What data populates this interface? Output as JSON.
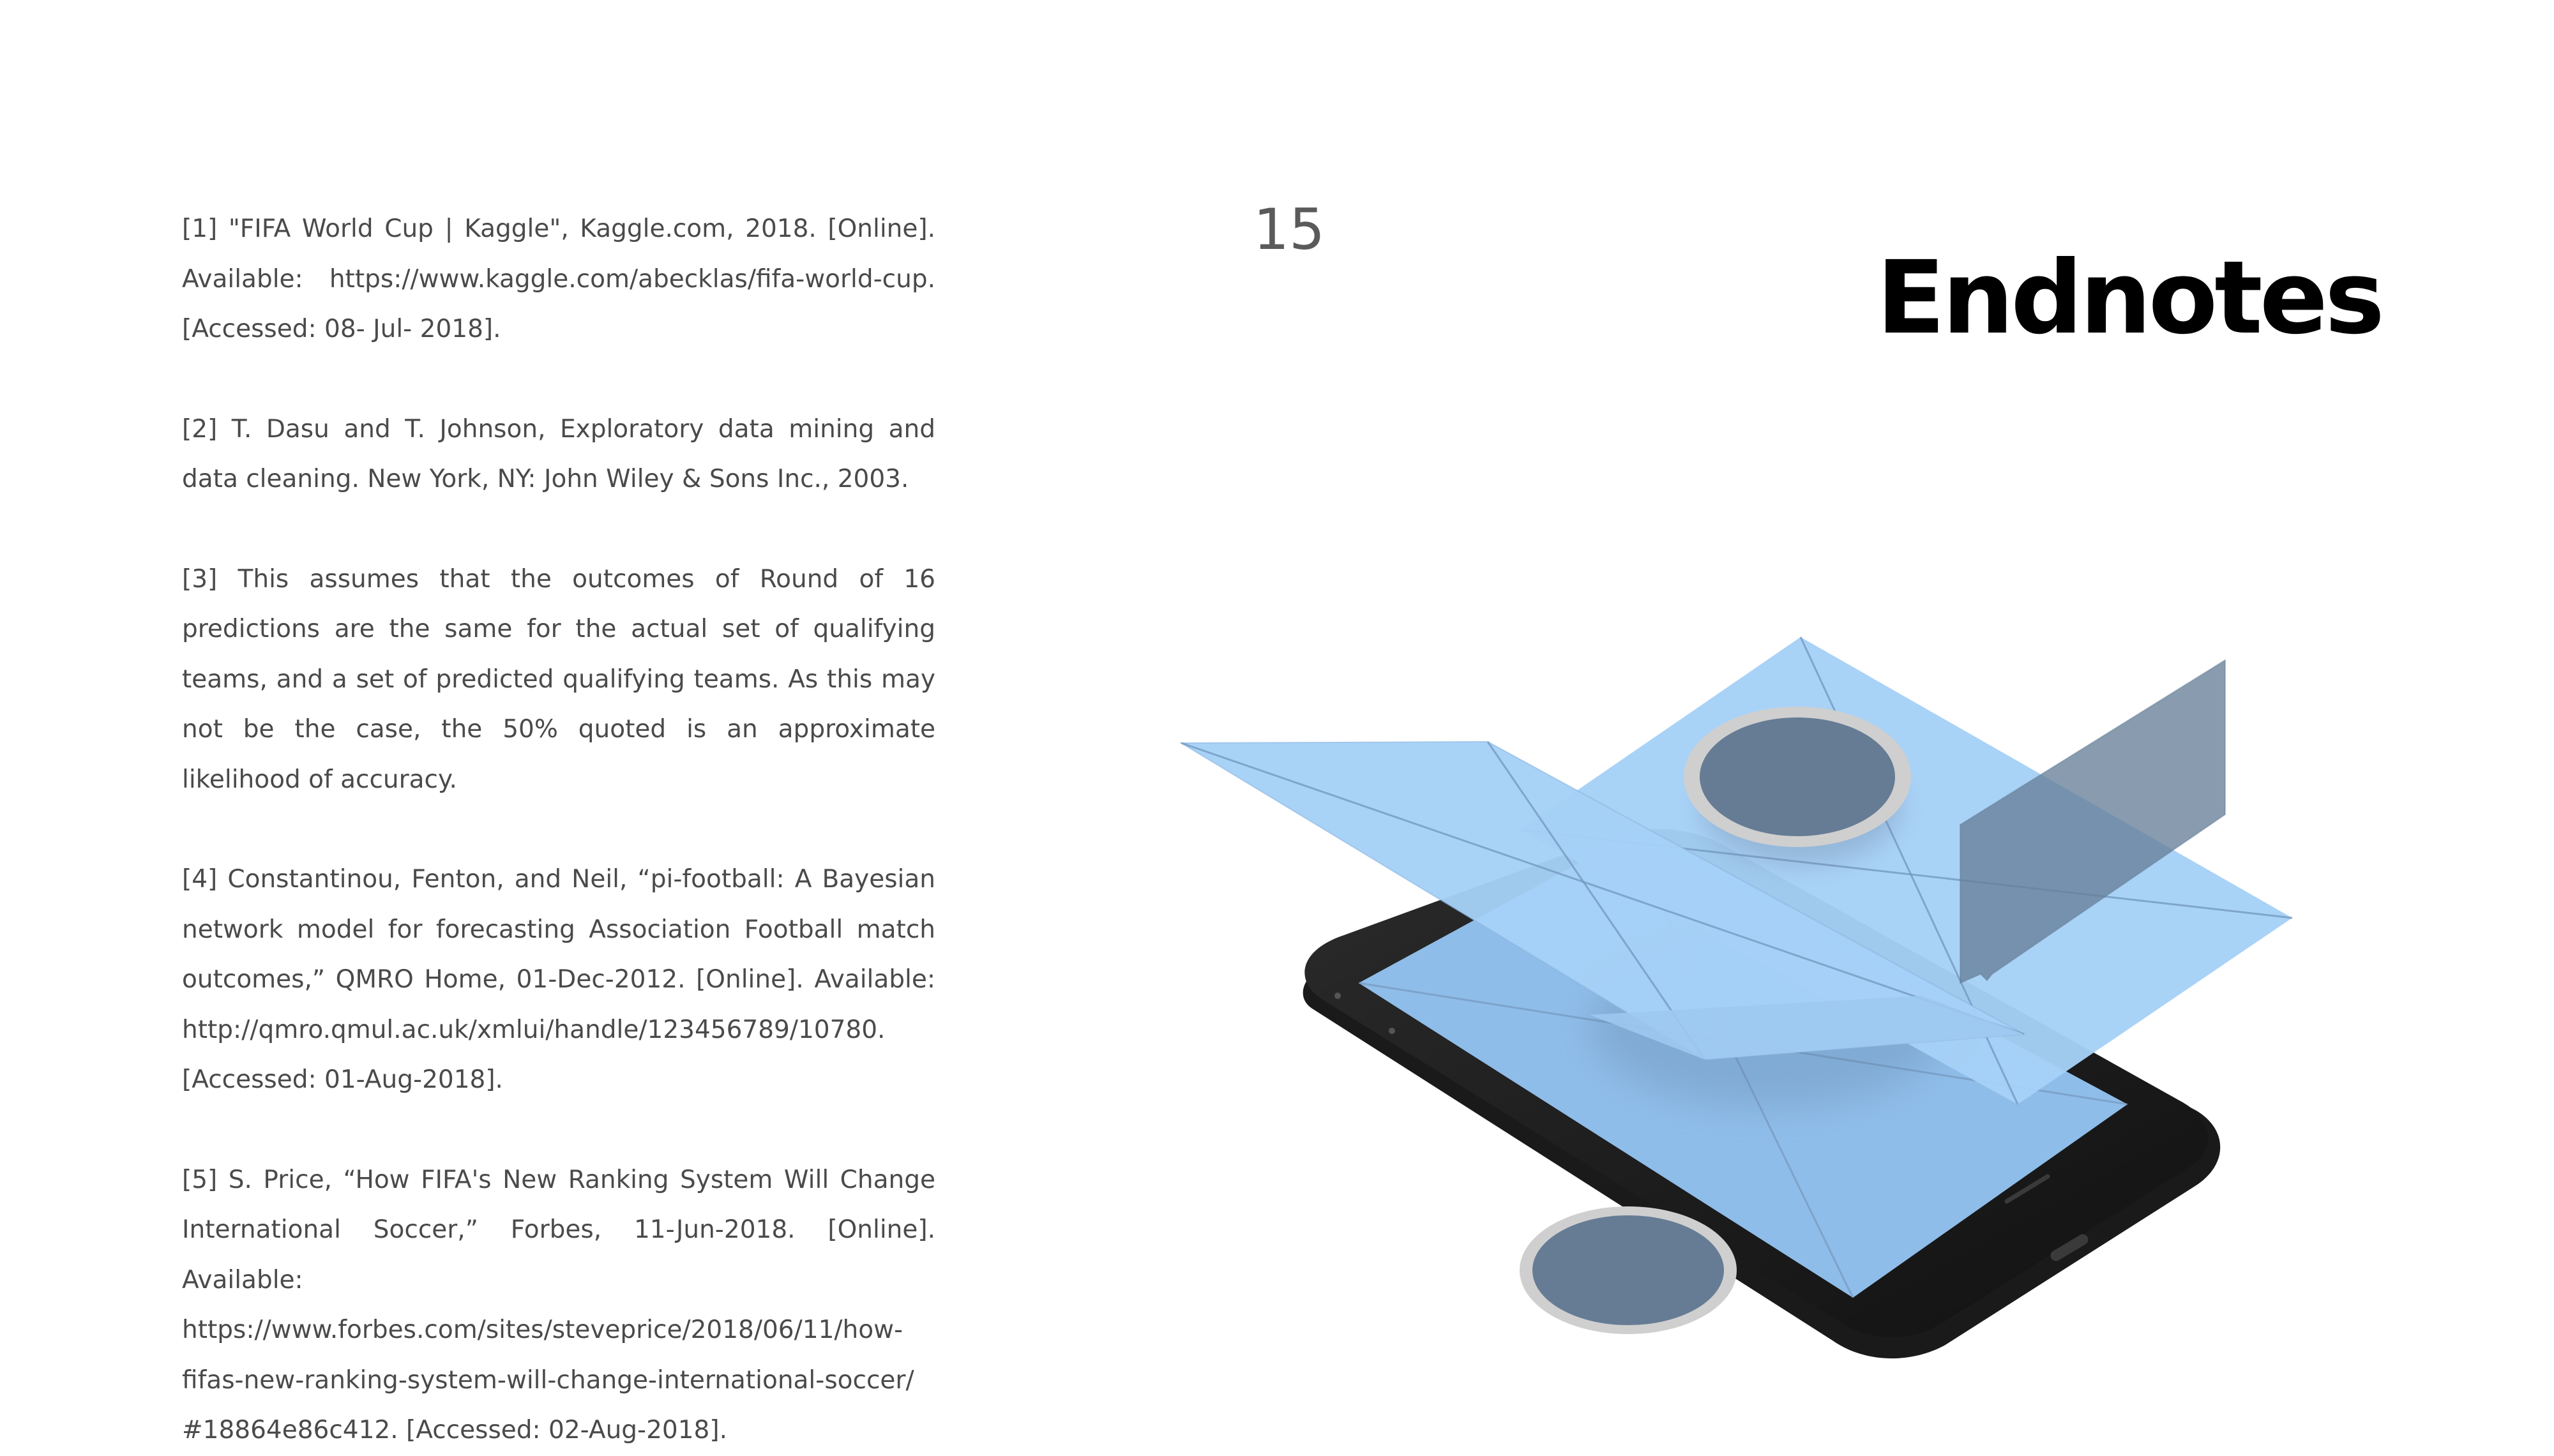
{
  "slide": {
    "page_number": "15",
    "title": "Endnotes",
    "endnotes": [
      "[1] \"FIFA World Cup | Kaggle\", Kaggle.com, 2018. [Online]. Available: https://www.kaggle.com/abecklas/fifa-world-cup. [Accessed: 08- Jul- 2018].",
      "[2] T. Dasu and T. Johnson, Exploratory data mining and data cleaning. New York, NY: John Wiley & Sons Inc., 2003.",
      "[3] This assumes that the outcomes of Round of 16 predictions are the same for the actual set of qualifying teams, and a set of predicted qualifying teams. As this may not be the case, the 50% quoted is an approximate likelihood of accuracy.",
      "[4] Constantinou, Fenton, and Neil, “pi-football: A Bayesian network model for forecasting Association Football match outcomes,” QMRO Home, 01-Dec-2012. [Online]. Available: http://qmro.qmul.ac.uk/xmlui/handle/123456789/10780. [Accessed: 01-Aug-2018].",
      "[5] S. Price, “How FIFA's New Ranking System Will Change International Soccer,” Forbes, 11-Jun-2018. [Online]. Available: https://www.forbes.com/sites/steveprice/2018/06/11/how-fifas-new-ranking-system-will-change-international-soccer/ #18864e86c412. [Accessed: 02-Aug-2018]."
    ]
  },
  "illustration": {
    "icons": [
      "isometric-smartphone-icon",
      "wireframe-panel-icon",
      "circle-placeholder-icon",
      "speech-bubble-icon"
    ],
    "colors": {
      "phone_body": "#242424",
      "phone_screen": "#8fbde9",
      "wireframe_panel": "#a6d0f7",
      "placeholder_fill": "#667c95",
      "placeholder_ring": "#cfcfcf",
      "speech_bubble": "#677f99"
    }
  }
}
